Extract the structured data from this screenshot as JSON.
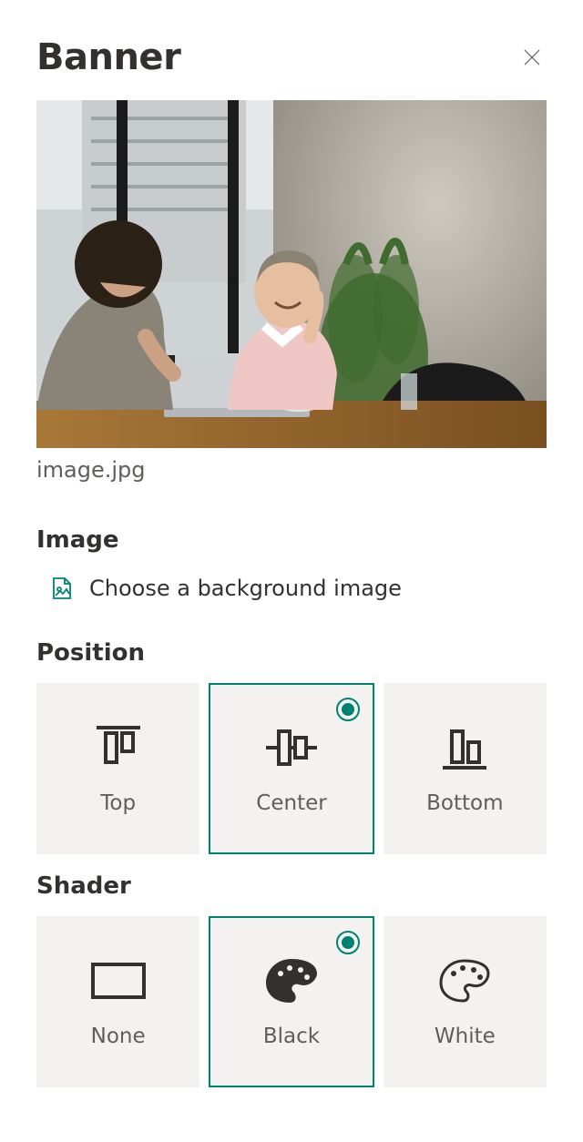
{
  "header": {
    "title": "Banner"
  },
  "preview": {
    "filename": "image.jpg"
  },
  "sections": {
    "image": {
      "heading": "Image",
      "choose_label": "Choose a background image"
    },
    "position": {
      "heading": "Position",
      "options": {
        "top": {
          "label": "Top",
          "selected": false
        },
        "center": {
          "label": "Center",
          "selected": true
        },
        "bottom": {
          "label": "Bottom",
          "selected": false
        }
      }
    },
    "shader": {
      "heading": "Shader",
      "options": {
        "none": {
          "label": "None",
          "selected": false
        },
        "black": {
          "label": "Black",
          "selected": true
        },
        "white": {
          "label": "White",
          "selected": false
        }
      }
    }
  },
  "colors": {
    "accent": "#008272"
  }
}
